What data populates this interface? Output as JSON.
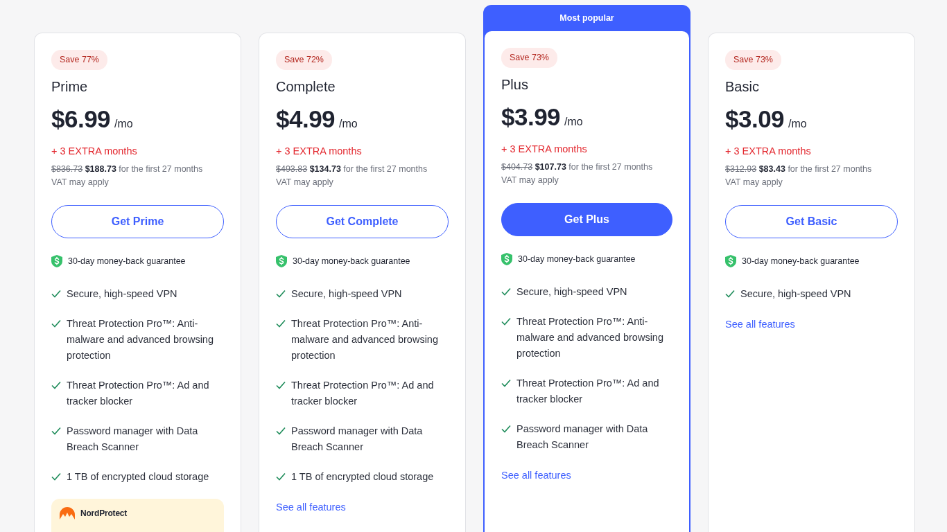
{
  "plans": [
    {
      "badge": "Save 77%",
      "name": "Prime",
      "price": "$6.99",
      "per": "/mo",
      "extra": "+ 3 EXTRA months",
      "old_price": "$836.73",
      "new_price": "$188.73",
      "term": "for the first 27 months",
      "vat": "VAT may apply",
      "button": "Get Prime",
      "popular": false,
      "guarantee": "30-day money-back guarantee",
      "features": [
        "Secure, high-speed VPN",
        "Threat Protection Pro™: Anti-malware and advanced browsing protection",
        "Threat Protection Pro™: Ad and tracker blocker",
        "Password manager with Data Breach Scanner",
        "1 TB of encrypted cloud storage"
      ],
      "addon": {
        "brand": "NordProtect"
      }
    },
    {
      "badge": "Save 72%",
      "name": "Complete",
      "price": "$4.99",
      "per": "/mo",
      "extra": "+ 3 EXTRA months",
      "old_price": "$493.83",
      "new_price": "$134.73",
      "term": "for the first 27 months",
      "vat": "VAT may apply",
      "button": "Get Complete",
      "popular": false,
      "guarantee": "30-day money-back guarantee",
      "features": [
        "Secure, high-speed VPN",
        "Threat Protection Pro™: Anti-malware and advanced browsing protection",
        "Threat Protection Pro™: Ad and tracker blocker",
        "Password manager with Data Breach Scanner",
        "1 TB of encrypted cloud storage"
      ],
      "see_all": "See all features"
    },
    {
      "ribbon": "Most popular",
      "badge": "Save 73%",
      "name": "Plus",
      "price": "$3.99",
      "per": "/mo",
      "extra": "+ 3 EXTRA months",
      "old_price": "$404.73",
      "new_price": "$107.73",
      "term": "for the first 27 months",
      "vat": "VAT may apply",
      "button": "Get Plus",
      "popular": true,
      "guarantee": "30-day money-back guarantee",
      "features": [
        "Secure, high-speed VPN",
        "Threat Protection Pro™: Anti-malware and advanced browsing protection",
        "Threat Protection Pro™: Ad and tracker blocker",
        "Password manager with Data Breach Scanner"
      ],
      "see_all": "See all features"
    },
    {
      "badge": "Save 73%",
      "name": "Basic",
      "price": "$3.09",
      "per": "/mo",
      "extra": "+ 3 EXTRA months",
      "old_price": "$312.93",
      "new_price": "$83.43",
      "term": "for the first 27 months",
      "vat": "VAT may apply",
      "button": "Get Basic",
      "popular": false,
      "guarantee": "30-day money-back guarantee",
      "features": [
        "Secure, high-speed VPN"
      ],
      "see_all": "See all features"
    }
  ]
}
